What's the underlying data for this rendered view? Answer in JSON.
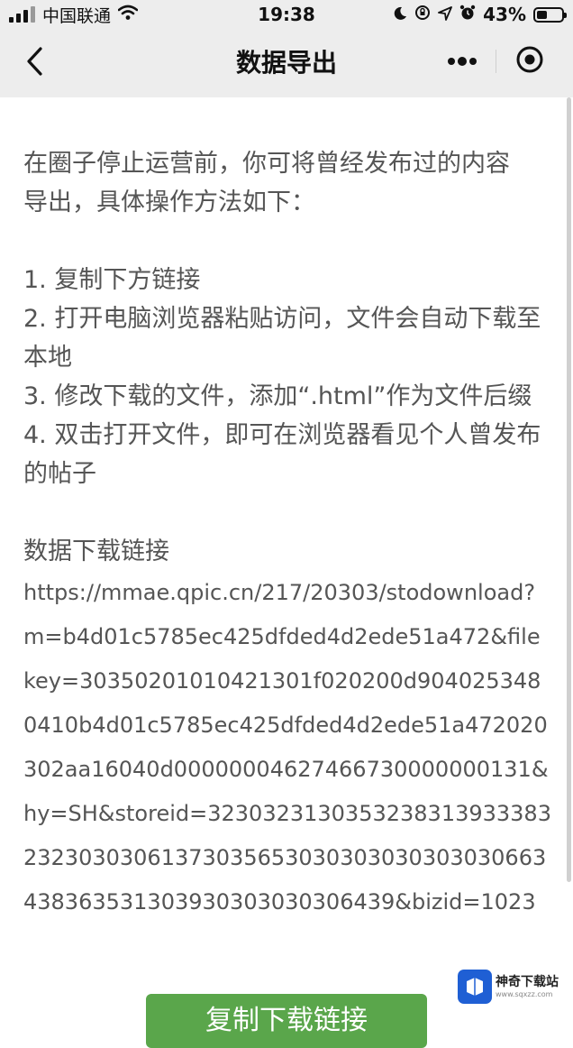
{
  "status_bar": {
    "carrier": "中国联通",
    "time": "19:38",
    "battery": "43%",
    "battery_level": 0.43
  },
  "nav": {
    "title": "数据导出",
    "back_icon": "chevron-left-icon",
    "more_icon": "more-dots-icon",
    "close_icon": "target-close-icon"
  },
  "content": {
    "intro_line1": "在圈子停止运营前，你可将曾经发布过的内容",
    "intro_line2": "导出，具体操作方法如下：",
    "steps": [
      "1. 复制下方链接",
      "2. 打开电脑浏览器粘贴访问，文件会自动下载至本地",
      "3. 修改下载的文件，添加“.html”作为文件后缀",
      "4. 双击打开文件，即可在浏览器看见个人曾发布的帖子"
    ],
    "link_heading": "数据下载链接",
    "link_url": "https://mmae.qpic.cn/217/20303/stodownload?m=b4d01c5785ec425dfded4d2ede51a472&filekey=30350201010421301f020200d9040253480410b4d01c5785ec425dfded4d2ede51a472020302aa16040d00000004627466730000000131&hy=SH&storeid=323032313035323831393338323230303061373035653030303030303030663438363531303930303030306439&bizid=1023"
  },
  "copy_button": {
    "label": "复制下载链接"
  },
  "watermark": {
    "name": "神奇下载站",
    "domain": "www.sqxzz.com"
  },
  "colors": {
    "status_bg": "#ededed",
    "text": "#555555",
    "button_green": "#5aa64b"
  }
}
